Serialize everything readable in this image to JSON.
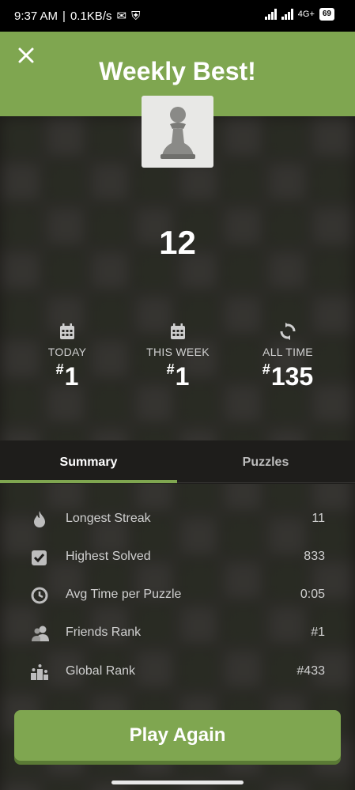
{
  "status_bar": {
    "time": "9:37 AM",
    "speed": "0.1KB/s",
    "network_label": "4G+",
    "battery": "69"
  },
  "header": {
    "title": "Weekly Best!",
    "close_icon": "close-icon",
    "background_color": "#7fa650"
  },
  "puzzle_piece_icon": "pawn-icon",
  "score": "12",
  "ranks": [
    {
      "label": "TODAY",
      "hash": "#",
      "value": "1",
      "icon": "calendar-icon"
    },
    {
      "label": "THIS WEEK",
      "hash": "#",
      "value": "1",
      "icon": "calendar-icon"
    },
    {
      "label": "ALL TIME",
      "hash": "#",
      "value": "135",
      "icon": "refresh-icon"
    }
  ],
  "tabs": [
    {
      "label": "Summary",
      "active": true
    },
    {
      "label": "Puzzles",
      "active": false
    }
  ],
  "summary": [
    {
      "label": "Longest Streak",
      "value": "11",
      "icon": "flame-icon"
    },
    {
      "label": "Highest Solved",
      "value": "833",
      "icon": "checkbox-icon"
    },
    {
      "label": "Avg Time per Puzzle",
      "value": "0:05",
      "icon": "clock-icon"
    },
    {
      "label": "Friends Rank",
      "value": "#1",
      "icon": "friends-icon"
    },
    {
      "label": "Global Rank",
      "value": "#433",
      "icon": "podium-icon"
    }
  ],
  "play_button": {
    "label": "Play Again"
  }
}
